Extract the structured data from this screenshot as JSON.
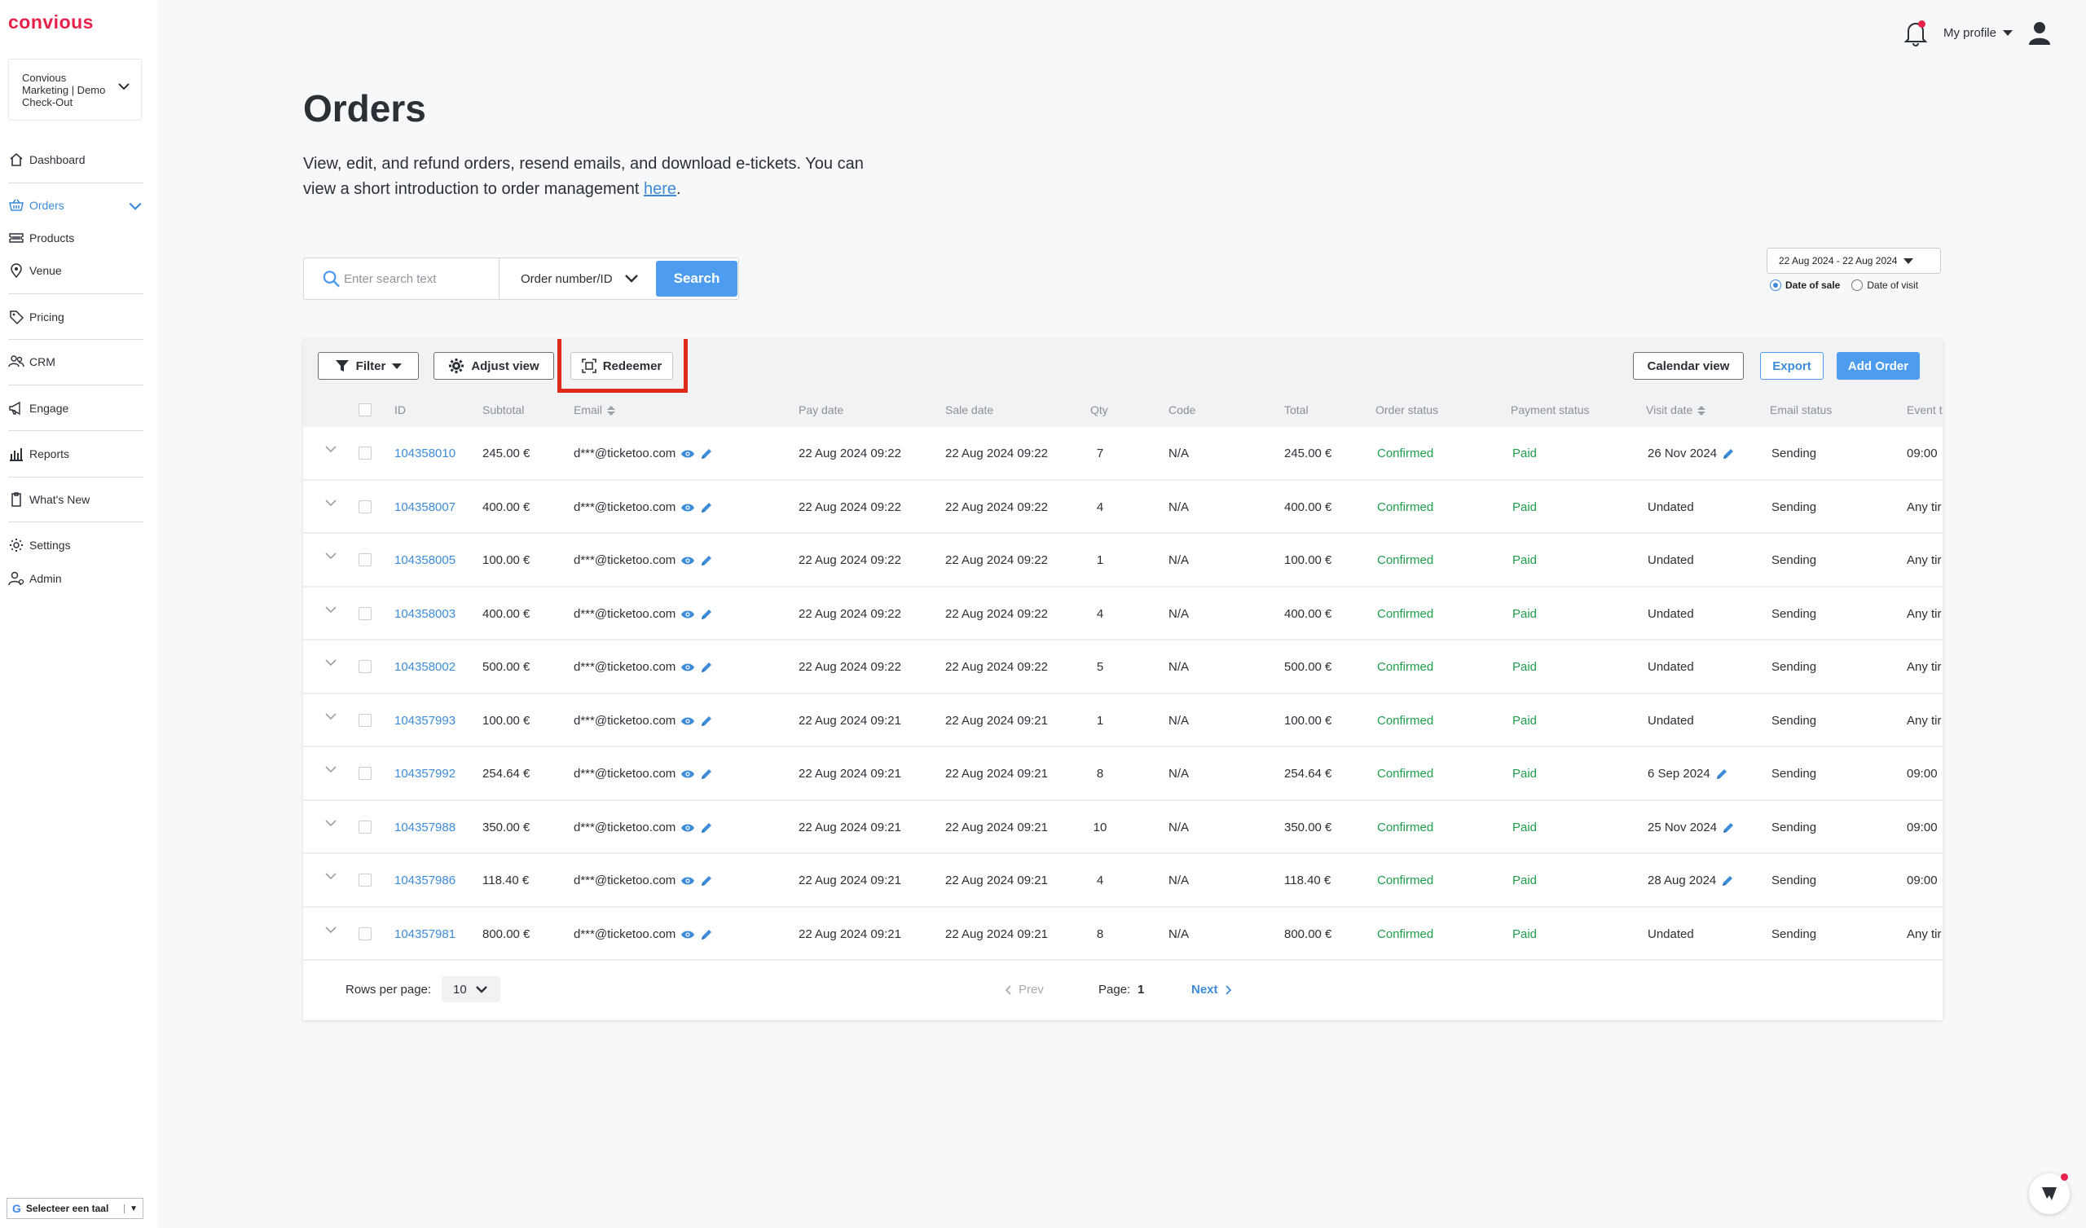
{
  "app": {
    "logo": "convious",
    "account": "Convious Marketing | Demo Check-Out"
  },
  "sidebar": {
    "items": [
      {
        "label": "Dashboard",
        "icon": "home-icon"
      },
      {
        "label": "Orders",
        "icon": "basket-icon",
        "active": true
      },
      {
        "label": "Products",
        "icon": "ticket-icon"
      },
      {
        "label": "Venue",
        "icon": "location-pin-icon"
      },
      {
        "label": "Pricing",
        "icon": "tag-icon"
      },
      {
        "label": "CRM",
        "icon": "people-icon"
      },
      {
        "label": "Engage",
        "icon": "megaphone-icon"
      },
      {
        "label": "Reports",
        "icon": "bar-chart-icon"
      },
      {
        "label": "What's New",
        "icon": "clipboard-icon"
      },
      {
        "label": "Settings",
        "icon": "gear-icon"
      },
      {
        "label": "Admin",
        "icon": "admin-user-icon"
      }
    ],
    "language": "Selecteer een taal"
  },
  "topbar": {
    "profile_label": "My profile"
  },
  "page": {
    "title": "Orders",
    "intro": "View, edit, and refund orders, resend emails, and download e-tickets. You can view a short introduction to order management ",
    "intro_link": "here",
    "intro_end": "."
  },
  "search": {
    "placeholder": "Enter search text",
    "type": "Order number/ID",
    "button": "Search"
  },
  "date_filter": {
    "range": "22 Aug 2024 - 22 Aug 2024",
    "options": [
      "Date of sale",
      "Date of visit"
    ],
    "selected": "Date of sale"
  },
  "toolbar": {
    "filter": "Filter",
    "adjust_view": "Adjust view",
    "redeemer": "Redeemer",
    "calendar_view": "Calendar view",
    "export": "Export",
    "add_order": "Add Order"
  },
  "table": {
    "columns": [
      "ID",
      "Subtotal",
      "Email",
      "Pay date",
      "Sale date",
      "Qty",
      "Code",
      "Total",
      "Order status",
      "Payment status",
      "Visit date",
      "Email status",
      "Event t"
    ],
    "rows": [
      {
        "id": "104358010",
        "subtotal": "245.00 €",
        "email": "d***@ticketoo.com",
        "pay_date": "22 Aug 2024 09:22",
        "sale_date": "22 Aug 2024 09:22",
        "qty": "7",
        "code": "N/A",
        "total": "245.00 €",
        "order_status": "Confirmed",
        "payment_status": "Paid",
        "visit_date": "26 Nov 2024",
        "visit_editable": true,
        "email_status": "Sending",
        "event": "09:00"
      },
      {
        "id": "104358007",
        "subtotal": "400.00 €",
        "email": "d***@ticketoo.com",
        "pay_date": "22 Aug 2024 09:22",
        "sale_date": "22 Aug 2024 09:22",
        "qty": "4",
        "code": "N/A",
        "total": "400.00 €",
        "order_status": "Confirmed",
        "payment_status": "Paid",
        "visit_date": "Undated",
        "visit_editable": false,
        "email_status": "Sending",
        "event": "Any tir"
      },
      {
        "id": "104358005",
        "subtotal": "100.00 €",
        "email": "d***@ticketoo.com",
        "pay_date": "22 Aug 2024 09:22",
        "sale_date": "22 Aug 2024 09:22",
        "qty": "1",
        "code": "N/A",
        "total": "100.00 €",
        "order_status": "Confirmed",
        "payment_status": "Paid",
        "visit_date": "Undated",
        "visit_editable": false,
        "email_status": "Sending",
        "event": "Any tir"
      },
      {
        "id": "104358003",
        "subtotal": "400.00 €",
        "email": "d***@ticketoo.com",
        "pay_date": "22 Aug 2024 09:22",
        "sale_date": "22 Aug 2024 09:22",
        "qty": "4",
        "code": "N/A",
        "total": "400.00 €",
        "order_status": "Confirmed",
        "payment_status": "Paid",
        "visit_date": "Undated",
        "visit_editable": false,
        "email_status": "Sending",
        "event": "Any tir"
      },
      {
        "id": "104358002",
        "subtotal": "500.00 €",
        "email": "d***@ticketoo.com",
        "pay_date": "22 Aug 2024 09:22",
        "sale_date": "22 Aug 2024 09:22",
        "qty": "5",
        "code": "N/A",
        "total": "500.00 €",
        "order_status": "Confirmed",
        "payment_status": "Paid",
        "visit_date": "Undated",
        "visit_editable": false,
        "email_status": "Sending",
        "event": "Any tir"
      },
      {
        "id": "104357993",
        "subtotal": "100.00 €",
        "email": "d***@ticketoo.com",
        "pay_date": "22 Aug 2024 09:21",
        "sale_date": "22 Aug 2024 09:21",
        "qty": "1",
        "code": "N/A",
        "total": "100.00 €",
        "order_status": "Confirmed",
        "payment_status": "Paid",
        "visit_date": "Undated",
        "visit_editable": false,
        "email_status": "Sending",
        "event": "Any tir"
      },
      {
        "id": "104357992",
        "subtotal": "254.64 €",
        "email": "d***@ticketoo.com",
        "pay_date": "22 Aug 2024 09:21",
        "sale_date": "22 Aug 2024 09:21",
        "qty": "8",
        "code": "N/A",
        "total": "254.64 €",
        "order_status": "Confirmed",
        "payment_status": "Paid",
        "visit_date": "6 Sep 2024",
        "visit_editable": true,
        "email_status": "Sending",
        "event": "09:00"
      },
      {
        "id": "104357988",
        "subtotal": "350.00 €",
        "email": "d***@ticketoo.com",
        "pay_date": "22 Aug 2024 09:21",
        "sale_date": "22 Aug 2024 09:21",
        "qty": "10",
        "code": "N/A",
        "total": "350.00 €",
        "order_status": "Confirmed",
        "payment_status": "Paid",
        "visit_date": "25 Nov 2024",
        "visit_editable": true,
        "email_status": "Sending",
        "event": "09:00"
      },
      {
        "id": "104357986",
        "subtotal": "118.40 €",
        "email": "d***@ticketoo.com",
        "pay_date": "22 Aug 2024 09:21",
        "sale_date": "22 Aug 2024 09:21",
        "qty": "4",
        "code": "N/A",
        "total": "118.40 €",
        "order_status": "Confirmed",
        "payment_status": "Paid",
        "visit_date": "28 Aug 2024",
        "visit_editable": true,
        "email_status": "Sending",
        "event": "09:00"
      },
      {
        "id": "104357981",
        "subtotal": "800.00 €",
        "email": "d***@ticketoo.com",
        "pay_date": "22 Aug 2024 09:21",
        "sale_date": "22 Aug 2024 09:21",
        "qty": "8",
        "code": "N/A",
        "total": "800.00 €",
        "order_status": "Confirmed",
        "payment_status": "Paid",
        "visit_date": "Undated",
        "visit_editable": false,
        "email_status": "Sending",
        "event": "Any tir"
      }
    ]
  },
  "pagination": {
    "rows_per_page_label": "Rows per page:",
    "rows_per_page": "10",
    "prev": "Prev",
    "page_label": "Page:",
    "page": "1",
    "next": "Next"
  },
  "colors": {
    "brand": "#e7224a",
    "accent": "#4d9cf0",
    "link": "#3d8bd9",
    "success": "#1e9e4a",
    "highlight": "#e02a1c"
  }
}
